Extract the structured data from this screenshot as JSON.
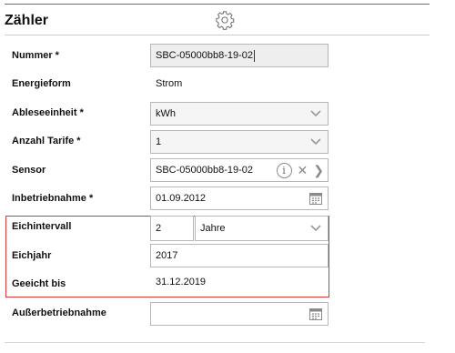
{
  "header": {
    "title": "Zähler",
    "icon": "gear-icon"
  },
  "fields": {
    "nummer": {
      "label": "Nummer *",
      "value": "SBC-05000bb8-19-02"
    },
    "energieform": {
      "label": "Energieform",
      "value": "Strom"
    },
    "ableseeinheit": {
      "label": "Ableseeinheit *",
      "value": "kWh"
    },
    "anzahl_tarife": {
      "label": "Anzahl Tarife *",
      "value": "1"
    },
    "sensor": {
      "label": "Sensor",
      "value": "SBC-05000bb8-19-02"
    },
    "inbetriebnahme": {
      "label": "Inbetriebnahme *",
      "value": "01.09.2012"
    },
    "eichintervall": {
      "label": "Eichintervall",
      "value": "2",
      "unit": "Jahre"
    },
    "eichjahr": {
      "label": "Eichjahr",
      "value": "2017"
    },
    "geeicht_bis": {
      "label": "Geeicht bis",
      "value": "31.12.2019"
    },
    "ausserbetriebnahme": {
      "label": "Außerbetriebnahme",
      "value": ""
    }
  },
  "colors": {
    "highlight_border": "#d43a3a",
    "input_border": "#b7b7b7"
  }
}
